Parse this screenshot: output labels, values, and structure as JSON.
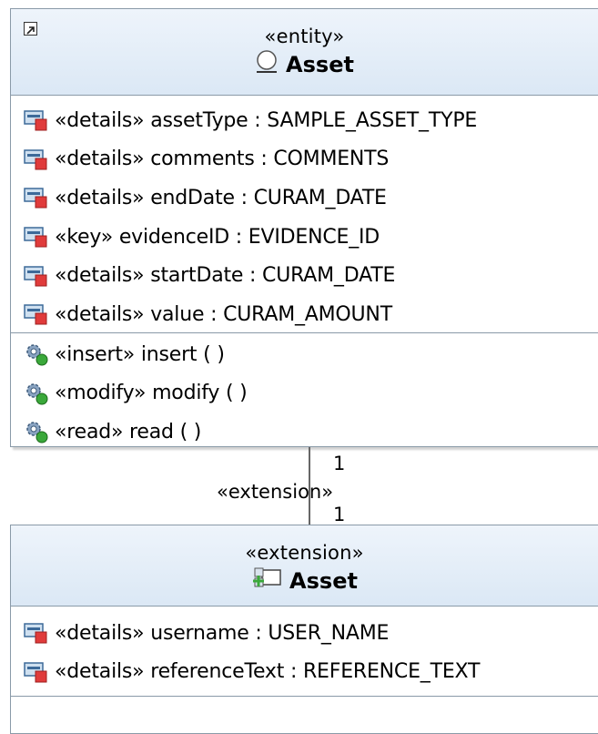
{
  "entity_class": {
    "stereotype": "«entity»",
    "name": "Asset",
    "icons": {
      "expand": "expand-arrow-icon",
      "class": "circle-entity-icon"
    },
    "attributes": [
      {
        "text": "«details» assetType : SAMPLE_ASSET_TYPE"
      },
      {
        "text": "«details» comments : COMMENTS"
      },
      {
        "text": "«details» endDate : CURAM_DATE"
      },
      {
        "text": "«key» evidenceID : EVIDENCE_ID"
      },
      {
        "text": "«details» startDate : CURAM_DATE"
      },
      {
        "text": "«details» value : CURAM_AMOUNT"
      }
    ],
    "operations": [
      {
        "text": "«insert» insert ( )"
      },
      {
        "text": "«modify» modify ( )"
      },
      {
        "text": "«read» read ( )"
      }
    ]
  },
  "connector": {
    "stereotype": "«extension»",
    "source_multiplicity": "1",
    "target_multiplicity": "1"
  },
  "extension_class": {
    "stereotype": "«extension»",
    "name": "Asset",
    "icons": {
      "class": "extension-class-icon"
    },
    "attributes": [
      {
        "text": "«details» username : USER_NAME"
      },
      {
        "text": "«details» referenceText : REFERENCE_TEXT"
      }
    ]
  },
  "colors": {
    "header_top": "#eef4fb",
    "header_bottom": "#dbe8f5",
    "border": "#8a9aa8",
    "attribute_icon_red": "#e03b3b",
    "operation_icon_green": "#3aa83a"
  }
}
